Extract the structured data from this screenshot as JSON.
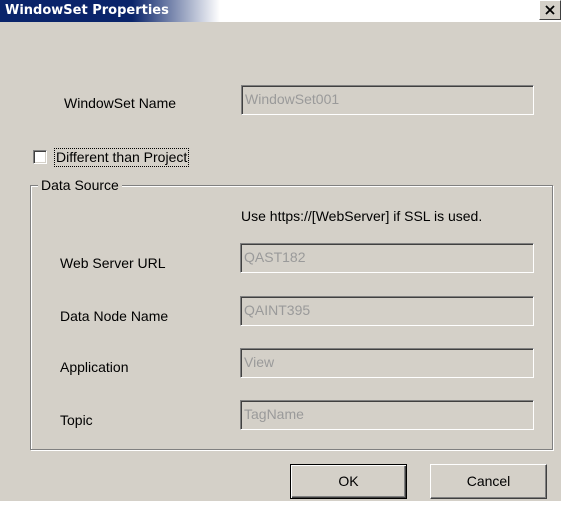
{
  "window": {
    "title": "WindowSet Properties"
  },
  "form": {
    "windowset_name_label": "WindowSet Name",
    "windowset_name_value": "WindowSet001",
    "different_than_project_label": "Different than Project",
    "different_than_project_checked": false
  },
  "data_source": {
    "legend": "Data Source",
    "ssl_hint": "Use https://[WebServer] if SSL is used.",
    "fields": [
      {
        "label": "Web Server URL",
        "value": "QAST182"
      },
      {
        "label": "Data Node Name",
        "value": "QAINT395"
      },
      {
        "label": "Application",
        "value": "View"
      },
      {
        "label": "Topic",
        "value": "TagName"
      }
    ]
  },
  "buttons": {
    "ok_label": "OK",
    "cancel_label": "Cancel"
  },
  "colors": {
    "titlebar": "#0a246a",
    "dialog_face": "#d4d0c8",
    "disabled_text": "#9a9a9a"
  }
}
